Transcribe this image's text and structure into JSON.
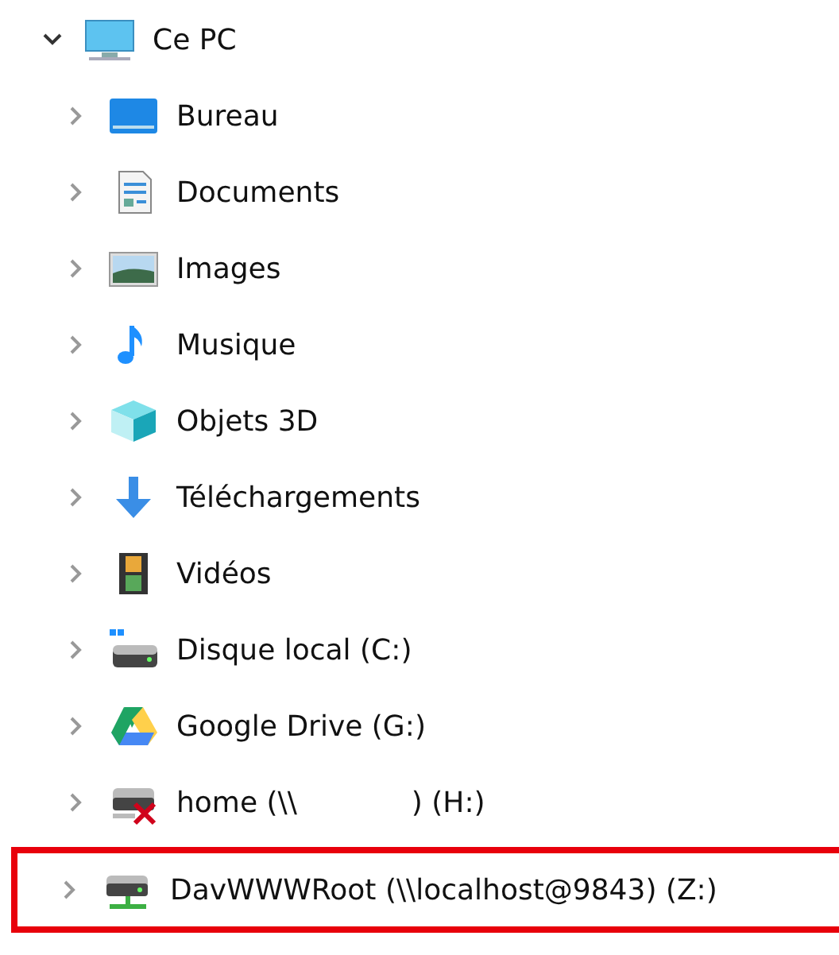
{
  "tree": {
    "label": "Ce PC",
    "kind": "pc",
    "expanded": true,
    "children": [
      {
        "label": "Bureau",
        "kind": "desktop",
        "expanded": false,
        "highlighted": false
      },
      {
        "label": "Documents",
        "kind": "documents",
        "expanded": false,
        "highlighted": false
      },
      {
        "label": "Images",
        "kind": "pictures",
        "expanded": false,
        "highlighted": false
      },
      {
        "label": "Musique",
        "kind": "music",
        "expanded": false,
        "highlighted": false
      },
      {
        "label": "Objets 3D",
        "kind": "objects3d",
        "expanded": false,
        "highlighted": false
      },
      {
        "label": "Téléchargements",
        "kind": "downloads",
        "expanded": false,
        "highlighted": false
      },
      {
        "label": "Vidéos",
        "kind": "videos",
        "expanded": false,
        "highlighted": false
      },
      {
        "label": "Disque local (C:)",
        "kind": "disk",
        "expanded": false,
        "highlighted": false
      },
      {
        "label": "Google Drive (G:)",
        "kind": "gdrive",
        "expanded": false,
        "highlighted": false
      },
      {
        "label": "home (\\\\",
        "label_after_gap": ") (H:)",
        "kind": "netdrive_off",
        "expanded": false,
        "highlighted": false
      },
      {
        "label": "DavWWWRoot (\\\\localhost@9843) (Z:)",
        "kind": "netdrive",
        "expanded": false,
        "highlighted": true
      }
    ]
  }
}
